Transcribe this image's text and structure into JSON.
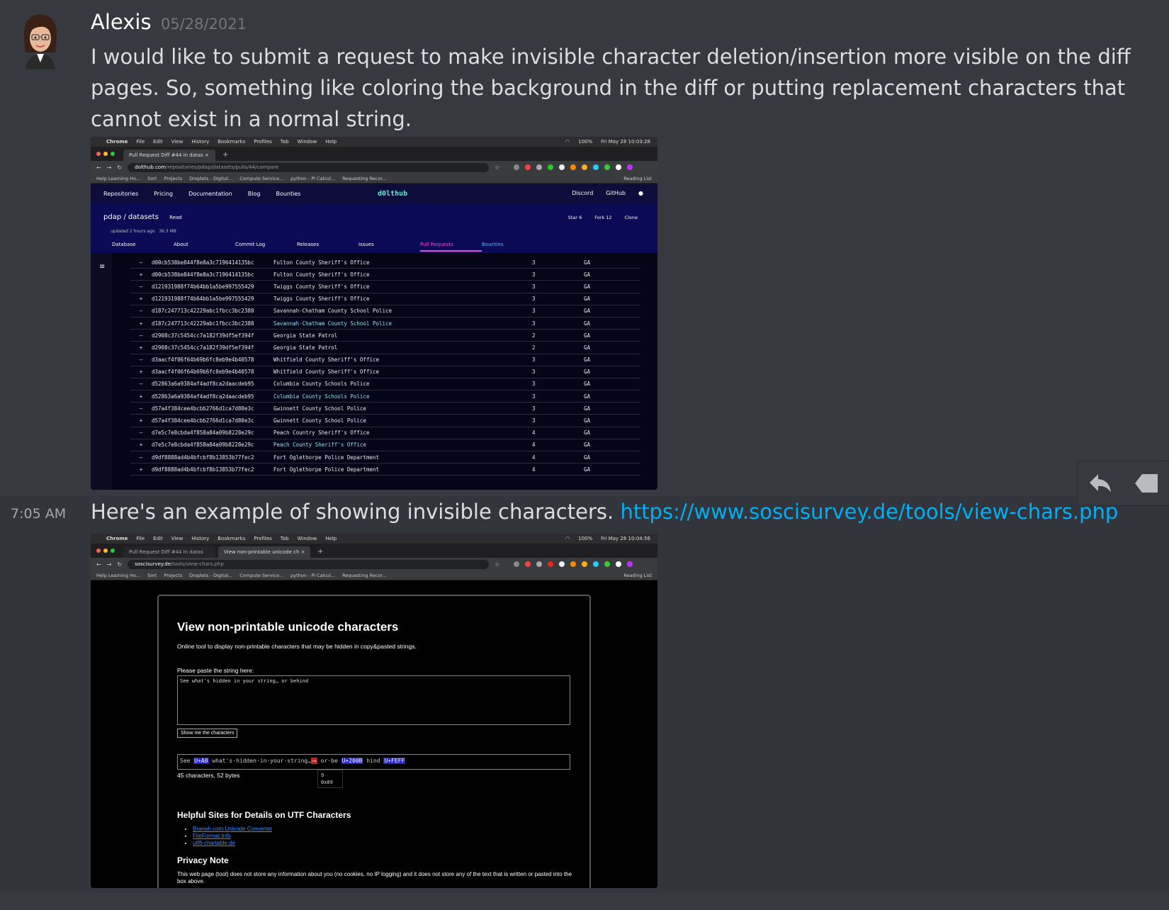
{
  "message1": {
    "author": "Alexis",
    "timestamp": "05/28/2021",
    "text": "I would like to submit a request to make invisible character deletion/insertion more visible on the diff pages. So, something like coloring the background in the diff or putting replacement characters that cannot exist in a normal string."
  },
  "message2": {
    "time": "7:05 AM",
    "text": "Here's an example of showing invisible characters. ",
    "link": "https://www.soscisurvey.de/tools/view-chars.php"
  },
  "actions": {
    "reply_icon": "reply-arrow-icon",
    "more_icon": "tag-icon"
  },
  "mac_menu": {
    "items": [
      "Chrome",
      "File",
      "Edit",
      "View",
      "History",
      "Bookmarks",
      "Profiles",
      "Tab",
      "Window",
      "Help"
    ],
    "battery": "100%",
    "clock1": "Fri May 28  10:03:28",
    "clock2": "Fri May 28  10:04:56"
  },
  "screenshot1": {
    "tab_title": "Pull Request Diff #44 in datas",
    "url_host": "dolthub.com",
    "url_path": "/repositories/pdap/datasets/pulls/44/compare",
    "bookmarks": [
      "Help Learning Ho...",
      "Sort",
      "Projects",
      "Droplets - Digital...",
      "Compute Service...",
      "python - Pi Calcul...",
      "Requesting Recor..."
    ],
    "reading_list": "Reading List",
    "nav": [
      "Repositories",
      "Pricing",
      "Documentation",
      "Blog",
      "Bounties"
    ],
    "logo": "d0lthub",
    "nav_right": [
      "Discord",
      "GitHub"
    ],
    "repo_owner": "pdap",
    "repo_sep": "/",
    "repo_name": "datasets",
    "repo_access": "Read",
    "updated": "updated 2 hours ago",
    "size": "36.3 MB",
    "star": "Star  6",
    "fork": "Fork  12",
    "clone": "Clone",
    "tabs": [
      "Database",
      "About",
      "Commit Log",
      "Releases",
      "Issues",
      "Pull Requests",
      "Bounties"
    ],
    "rows": [
      {
        "sign": "–",
        "id": "d00cb538be844f8e8a3c7196414135bc",
        "name": "Fulton County Sheriff's Office",
        "num": "3",
        "state": "GA",
        "added": false
      },
      {
        "sign": "+",
        "id": "d00cb538be844f8e8a3c7196414135bc",
        "name": "Fulton County Sheriff's Office",
        "num": "3",
        "state": "GA",
        "added": false
      },
      {
        "sign": "–",
        "id": "d121931988f74b64bb1a5be997555429",
        "name": "Twiggs County Sheriff's Office",
        "num": "3",
        "state": "GA",
        "added": false
      },
      {
        "sign": "+",
        "id": "d121931988f74b64bb1a5be997555429",
        "name": "Twiggs County Sheriff's Office",
        "num": "3",
        "state": "GA",
        "added": false
      },
      {
        "sign": "–",
        "id": "d187c247713c42229abc1fbcc3bc2388",
        "name": "Savannah-Chatham County School Police",
        "num": "3",
        "state": "GA",
        "added": false
      },
      {
        "sign": "+",
        "id": "d187c247713c42229abc1fbcc3bc2388",
        "name": "Savannah-Chatham County School Police",
        "num": "3",
        "state": "GA",
        "added": true
      },
      {
        "sign": "–",
        "id": "d2908c37c5454cc7a182f39df5ef394f",
        "name": "Georgia State Patrol",
        "num": "2",
        "state": "GA",
        "added": false
      },
      {
        "sign": "+",
        "id": "d2908c37c5454cc7a182f39df5ef394f",
        "name": "Georgia State Patrol",
        "num": "2",
        "state": "GA",
        "added": false
      },
      {
        "sign": "–",
        "id": "d3aacf4f06f64b69b6fc8eb9e4b40578",
        "name": "Whitfield County Sheriff's Office",
        "num": "3",
        "state": "GA",
        "added": false
      },
      {
        "sign": "+",
        "id": "d3aacf4f06f64b69b6fc8eb9e4b40578",
        "name": "Whitfield County Sheriff's Office",
        "num": "3",
        "state": "GA",
        "added": false
      },
      {
        "sign": "–",
        "id": "d52863a6a9384af4adf8ca2daacdeb95",
        "name": "Columbia County Schools Police",
        "num": "3",
        "state": "GA",
        "added": false
      },
      {
        "sign": "+",
        "id": "d52863a6a9384af4adf8ca2daacdeb95",
        "name": "Columbia County Schools Police",
        "num": "3",
        "state": "GA",
        "added": true
      },
      {
        "sign": "–",
        "id": "d57a4f384cee4bcbb2766d1ca7d80e3c",
        "name": "Gwinnett County School Police",
        "num": "3",
        "state": "GA",
        "added": false
      },
      {
        "sign": "+",
        "id": "d57a4f384cee4bcbb2766d1ca7d80e3c",
        "name": "Gwinnett County School Police",
        "num": "3",
        "state": "GA",
        "added": false
      },
      {
        "sign": "–",
        "id": "d7e5c7e8cbda4f858a84a09b8228e29c",
        "name": "Peach Country Sheriff's Office",
        "num": "4",
        "state": "GA",
        "added": false
      },
      {
        "sign": "+",
        "id": "d7e5c7e8cbda4f858a84a09b8228e29c",
        "name": "Peach County Sheriff's Office",
        "num": "4",
        "state": "GA",
        "added": true
      },
      {
        "sign": "–",
        "id": "d9df8888ad4b4bfcbf8b13853b77fec2",
        "name": "Fort Oglethorpe Police Department",
        "num": "4",
        "state": "GA",
        "added": false
      },
      {
        "sign": "+",
        "id": "d9df8888ad4b4bfcbf8b13853b77fec2",
        "name": "Fort Oglethorpe Police Department",
        "num": "4",
        "state": "GA",
        "added": false
      }
    ]
  },
  "screenshot2": {
    "tab1": "Pull Request Diff #44 in datas",
    "tab2": "View non-printable unicode ch",
    "url_host": "soscisurvey.de",
    "url_path": "/tools/view-chars.php",
    "title": "View non-printable unicode characters",
    "description": "Online tool to display non-printable characters that may be hidden in copy&pasted strings.",
    "input_label": "Please paste the string here:",
    "input_value": "See what's hidden in your string…      or behind",
    "button": "Show me the characters",
    "output": {
      "p1": "See ",
      "u1": "U+A0",
      "p2": " what's·hidden·in·your·string…",
      "tab": "⟶",
      "p3": " or·be ",
      "u2": "U+200B",
      "p4": " hind ",
      "u3": "U+FEFF"
    },
    "tooltip": [
      "9",
      "0x09"
    ],
    "count": "45 characters, 52 bytes",
    "helpful_heading": "Helpful Sites for Details on UTF Characters",
    "links": [
      "Branah.com Unicode Converter",
      "FileFormat.Info",
      "utf8-chartable.de"
    ],
    "privacy_heading": "Privacy Note",
    "privacy_text": "This web page (tool) does not store any information about you (no cookies, no IP logging) and it does not store any of the text that is written or pasted into the box above."
  }
}
